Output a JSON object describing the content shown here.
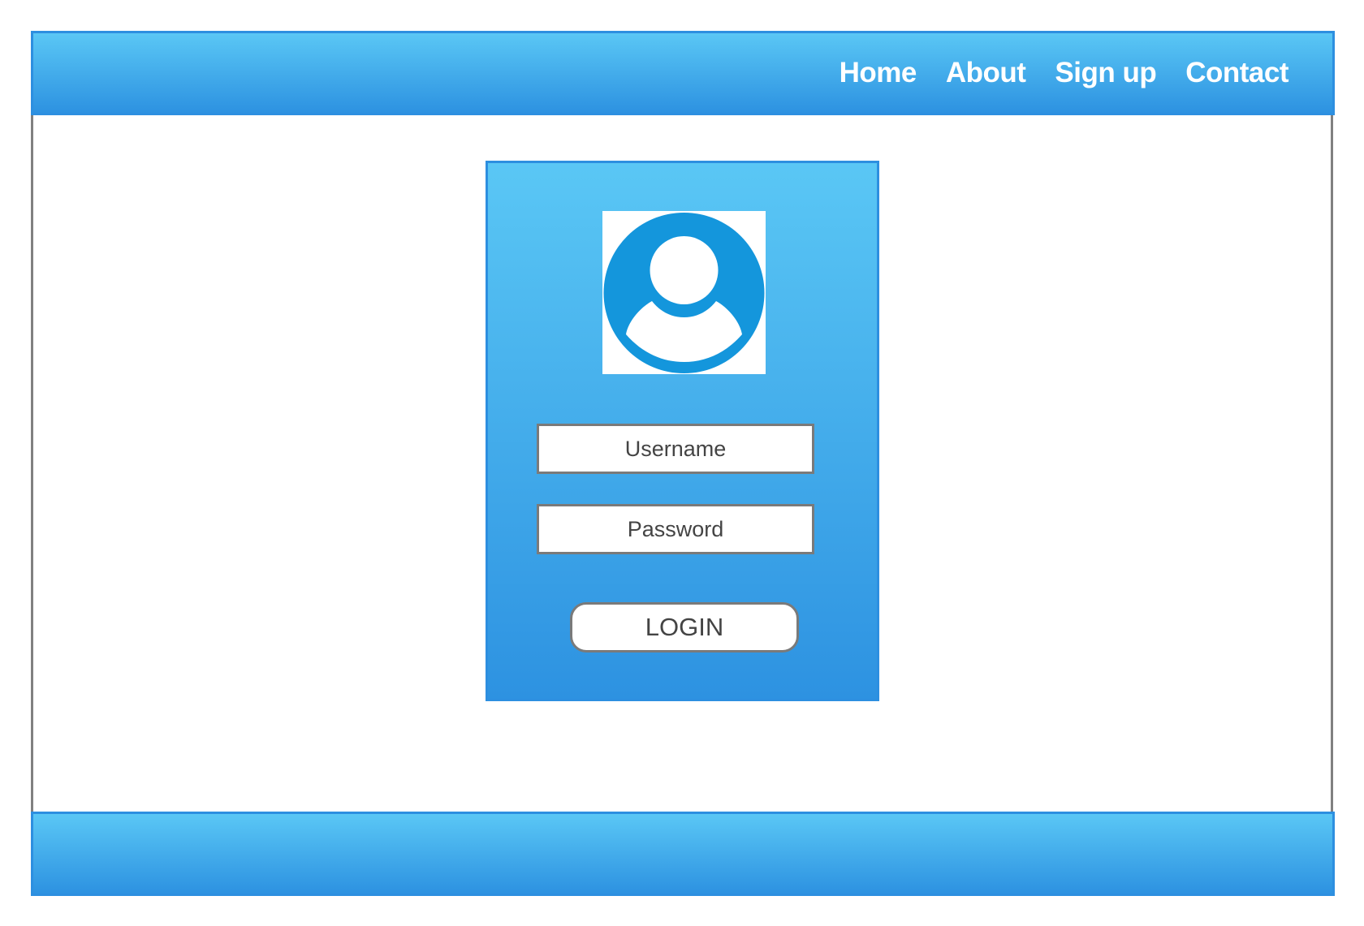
{
  "nav": {
    "items": [
      "Home",
      "About",
      "Sign up",
      "Contact"
    ]
  },
  "login": {
    "username_placeholder": "Username",
    "password_placeholder": "Password",
    "button_label": "LOGIN"
  },
  "colors": {
    "accent_light": "#5ac7f5",
    "accent_dark": "#2d92e1",
    "avatar_blue": "#1496dc",
    "border_gray": "#7a7a7a"
  },
  "icons": {
    "avatar": "user-avatar-icon"
  }
}
